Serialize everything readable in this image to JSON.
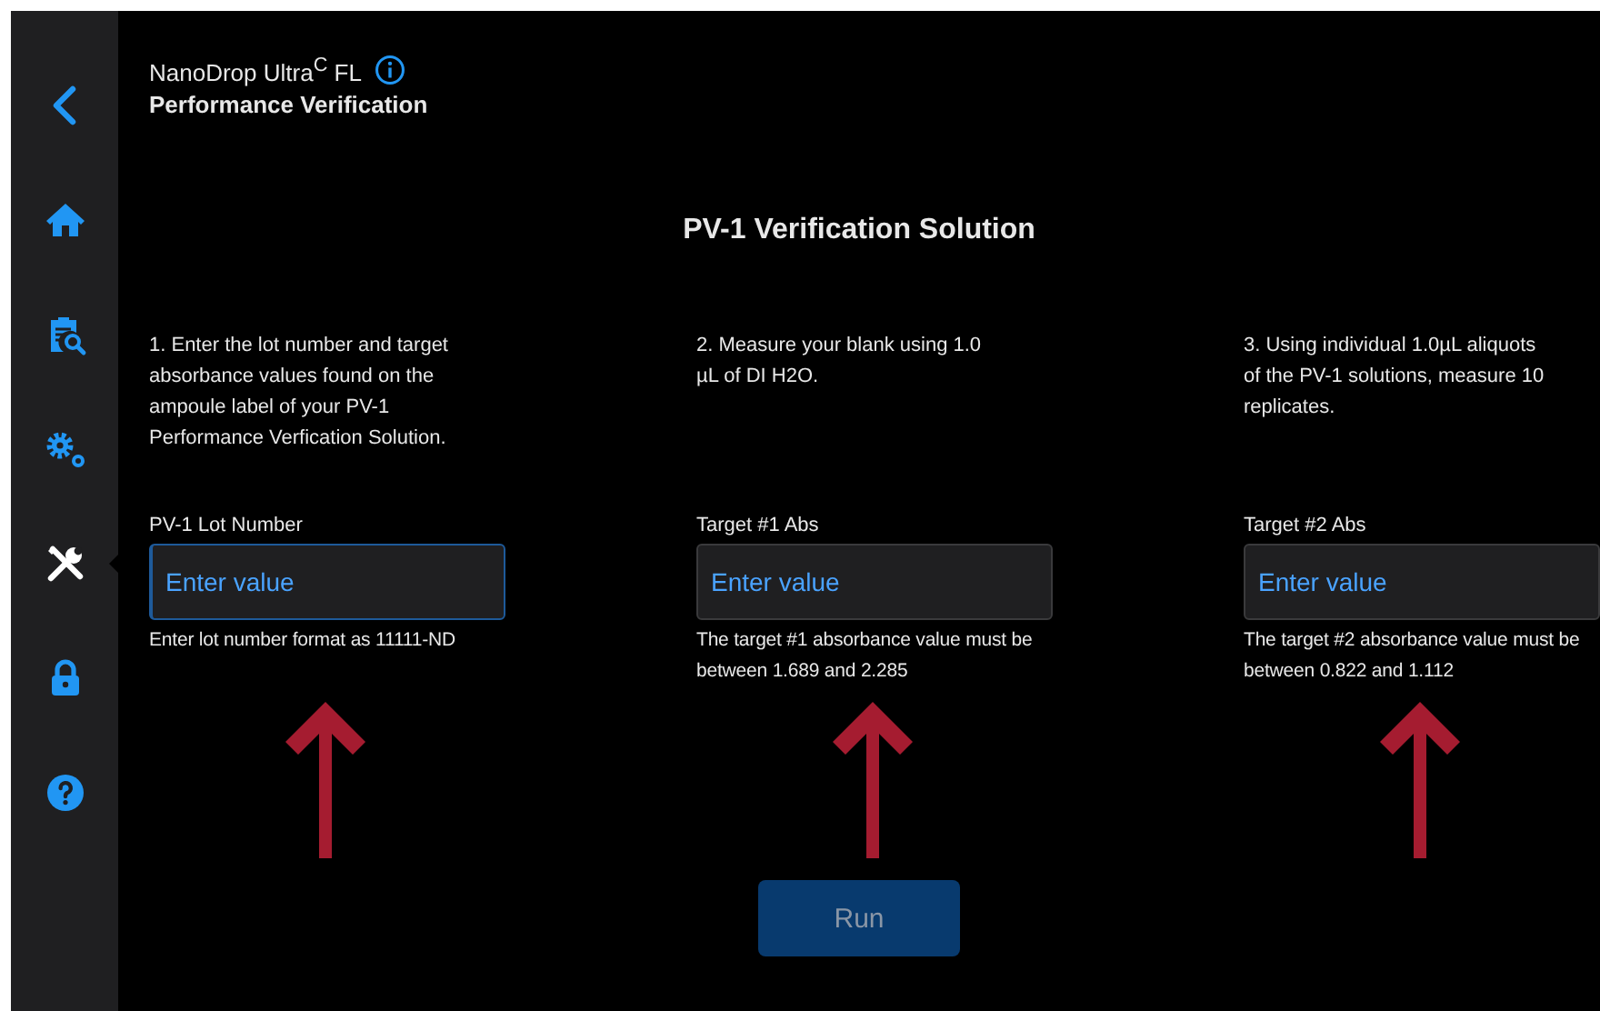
{
  "sidebar": {
    "items": [
      {
        "kind": "back",
        "selected": false
      },
      {
        "kind": "home",
        "selected": false
      },
      {
        "kind": "report",
        "selected": false
      },
      {
        "kind": "settings",
        "selected": false
      },
      {
        "kind": "tools",
        "selected": true
      },
      {
        "kind": "lock",
        "selected": false
      },
      {
        "kind": "help",
        "selected": false
      }
    ]
  },
  "header": {
    "product": "NanoDrop Ultra$^{C}$ FL",
    "title": "Performance Verification"
  },
  "section_title": "PV-1 Verification Solution",
  "steps": [
    {
      "instruction": "1. Enter the lot number and target absorbance values found on the ampoule label of your PV-1 Performance Verfication Solution.",
      "label": "PV-1 Lot Number",
      "placeholder": "Enter value",
      "focused": true,
      "hint": "Enter lot number format as 11111-ND"
    },
    {
      "instruction": "2. Measure your blank using 1.0 µL of DI H2O.",
      "label": "Target #1 Abs",
      "placeholder": "Enter value",
      "focused": false,
      "hint": "The target #1 absorbance value must be between 1.689 and 2.285"
    },
    {
      "instruction": "3. Using individual 1.0µL aliquots of the PV-1 solutions, measure 10 replicates.",
      "label": "Target #2 Abs",
      "placeholder": "Enter value",
      "focused": false,
      "hint": "The target #2 absorbance value must be between 0.822 and 1.112"
    }
  ],
  "run_button": {
    "label": "Run",
    "disabled": true
  }
}
